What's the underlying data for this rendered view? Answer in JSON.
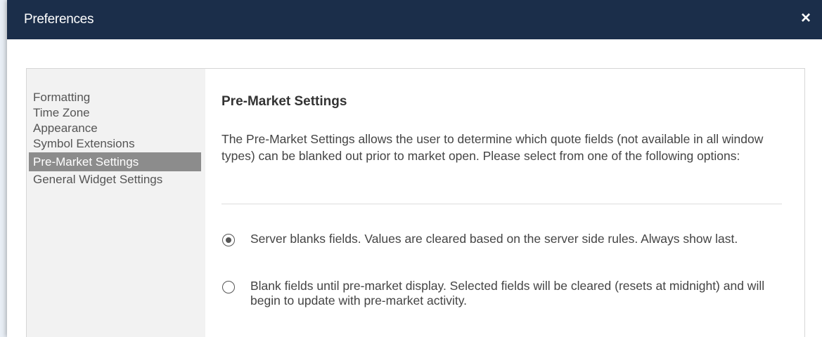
{
  "window": {
    "title": "Preferences",
    "close_glyph": "×"
  },
  "sidebar": {
    "items": [
      {
        "label": "Formatting"
      },
      {
        "label": "Time Zone"
      },
      {
        "label": "Appearance"
      },
      {
        "label": "Symbol Extensions"
      },
      {
        "label": "Pre-Market Settings"
      },
      {
        "label": "General Widget Settings"
      }
    ],
    "active_index": 4
  },
  "main": {
    "heading": "Pre-Market Settings",
    "description": "The Pre-Market Settings allows the user to determine which quote fields (not available in all window types) can be blanked out prior to market open. Please select from one of the following options:",
    "options": [
      {
        "label": "Server blanks fields. Values are cleared based on the server side rules. Always show last.",
        "selected": true
      },
      {
        "label": "Blank fields until pre-market display. Selected fields will be cleared (resets at midnight) and will begin to update with pre-market activity.",
        "selected": false
      }
    ]
  },
  "colors": {
    "titlebar": "#1b2e4a",
    "active_nav": "#8c8c8c",
    "sidebar_bg": "#f2f2f2"
  }
}
